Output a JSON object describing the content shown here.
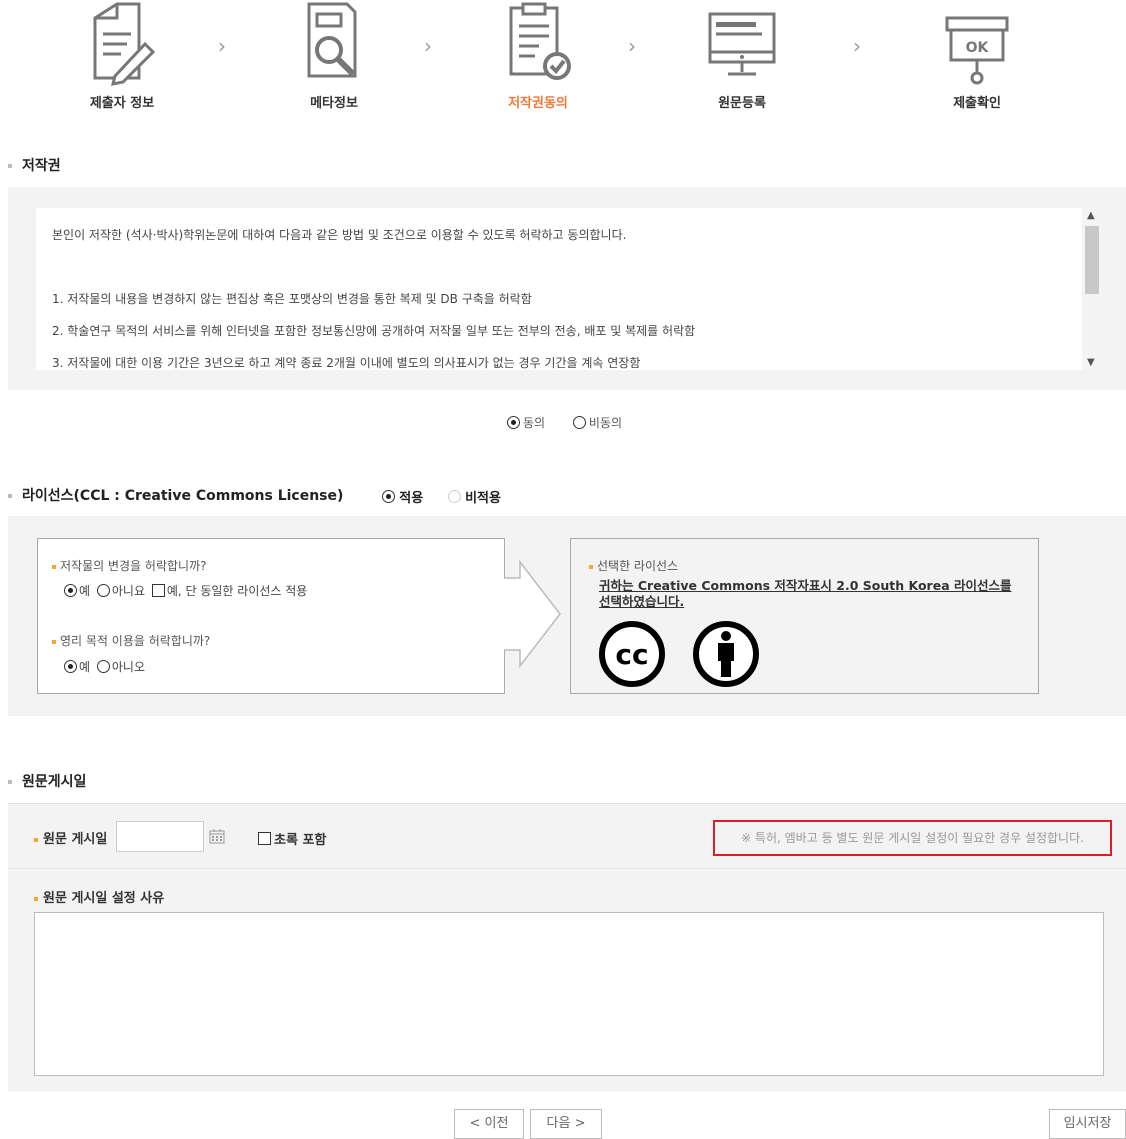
{
  "steps": [
    {
      "label": "제출자 정보",
      "icon": "document-pen-icon"
    },
    {
      "label": "메타정보",
      "icon": "document-search-icon"
    },
    {
      "label": "저작권동의",
      "icon": "document-check-icon",
      "active": true
    },
    {
      "label": "원문등록",
      "icon": "monitor-icon"
    },
    {
      "label": "제출확인",
      "icon": "ok-stamp-icon"
    }
  ],
  "copyright": {
    "title": "저작권",
    "intro": "본인이 저작한 (석사·박사)학위논문에 대하여 다음과 같은 방법 및 조건으로 이용할 수 있도록 허락하고 동의합니다.",
    "items": [
      "1. 저작물의 내용을 변경하지 않는 편집상 혹은 포맷상의 변경을 통한 복제 및 DB 구축을 허락함",
      "2. 학술연구 목적의 서비스를 위해 인터넷을 포함한 정보통신망에 공개하여 저작물 일부 또는 전부의 전송, 배포 및 복제를 허락함",
      "3. 저작물에 대한 이용 기간은 3년으로 하고 계약 종료 2개월 이내에 별도의 의사표시가 없는 경우 기간을 계속 연장함"
    ],
    "agree_label": "동의",
    "disagree_label": "비동의",
    "selected": "agree"
  },
  "license": {
    "title": "라이선스(CCL : Creative Commons License)",
    "apply_label": "적용",
    "not_apply_label": "비적용",
    "q1": "저작물의 변경을 허락합니까?",
    "q1_options": [
      "예",
      "아니요",
      "예, 단 동일한 라이선스 적용"
    ],
    "q2": "영리 목적 이용을 허락합니까?",
    "q2_options": [
      "예",
      "아니오"
    ],
    "selected_title": "선택한 라이선스",
    "selected_text": "귀하는 Creative Commons 저작자표시 2.0 South Korea 라이선스를 선택하였습니다."
  },
  "posting": {
    "title": "원문게시일",
    "date_label": "원문 게시일",
    "date_value": "",
    "abstract_label": "초록 포함",
    "notice": "※ 특허, 엠바고 등 별도 원문 게시일 설정이 필요한 경우 설정합니다.",
    "reason_label": "원문 게시일 설정 사유",
    "reason_value": ""
  },
  "buttons": {
    "prev": "< 이전",
    "next": "다음 >",
    "save": "임시저장"
  },
  "colors": {
    "active_step": "#f07a3a",
    "bullet": "#f0a830",
    "notice_border": "#d9202a"
  }
}
